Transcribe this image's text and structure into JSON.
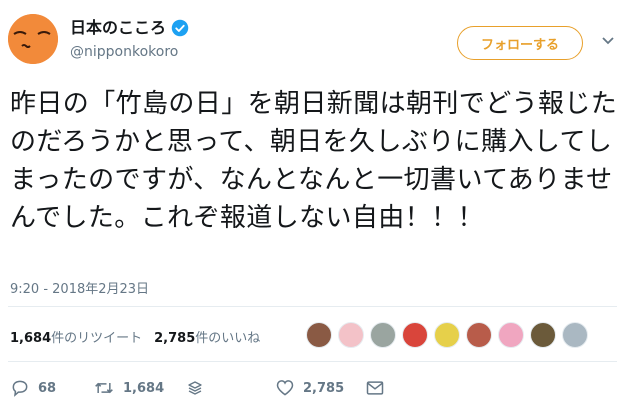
{
  "profile": {
    "display_name": "日本のこころ",
    "handle": "@nipponkokoro",
    "verified": true,
    "avatar_color": "#f28a3a"
  },
  "follow_button": {
    "label": "フォローする",
    "color": "#e8a02b"
  },
  "tweet": {
    "text": "昨日の「竹島の日」を朝日新聞は朝刊でどう報じたのだろうかと思って、朝日を久しぶりに購入してしまったのですが、なんとなんと一切書いてありませんでした。これぞ報道しない自由！！！",
    "timestamp": "9:20 - 2018年2月23日"
  },
  "stats": {
    "retweets": {
      "count": "1,684",
      "label": "件のリツイート"
    },
    "likes": {
      "count": "2,785",
      "label": "件のいいね"
    }
  },
  "likers": [
    {
      "color": "#8a5a44"
    },
    {
      "color": "#f3c2c8"
    },
    {
      "color": "#9aa5a0"
    },
    {
      "color": "#d9453b"
    },
    {
      "color": "#e6d04a"
    },
    {
      "color": "#b85c4a"
    },
    {
      "color": "#f0a6c0"
    },
    {
      "color": "#6b5a3a"
    },
    {
      "color": "#aab8c2"
    }
  ],
  "actions": {
    "reply_count": "68",
    "retweet_count": "1,684",
    "like_count": "2,785"
  },
  "icons": {
    "verified": "verified-badge-icon",
    "caret": "chevron-down-icon",
    "reply": "reply-icon",
    "retweet": "retweet-icon",
    "stack": "stack-icon",
    "like": "heart-icon",
    "dm": "envelope-icon"
  }
}
